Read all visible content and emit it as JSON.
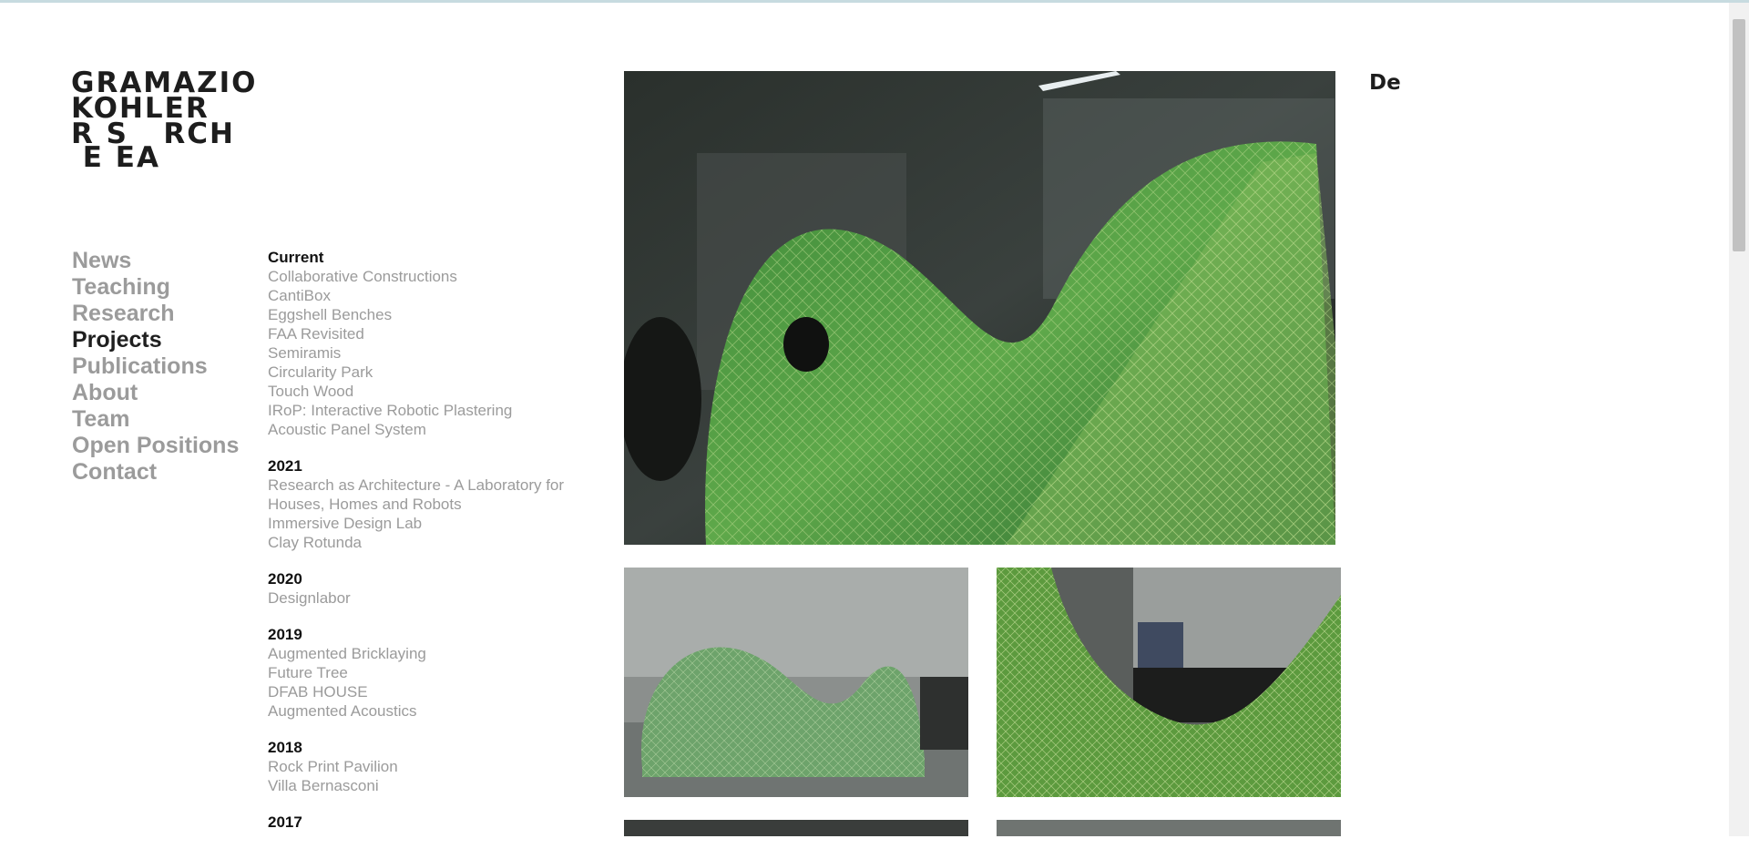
{
  "logo": {
    "line1": "GRAMAZIO",
    "line2": "KOHLER",
    "line3": "R S   RCH",
    "line4": " E EA"
  },
  "nav": {
    "items": [
      {
        "label": "News",
        "active": false
      },
      {
        "label": "Teaching",
        "active": false
      },
      {
        "label": "Research",
        "active": false
      },
      {
        "label": "Projects",
        "active": true
      },
      {
        "label": "Publications",
        "active": false
      },
      {
        "label": "About",
        "active": false
      },
      {
        "label": "Team",
        "active": false
      },
      {
        "label": "Open Positions",
        "active": false
      },
      {
        "label": "Contact",
        "active": false
      }
    ]
  },
  "projects": {
    "groups": [
      {
        "year": "Current",
        "items": [
          "Collaborative Constructions",
          "CantiBox",
          "Eggshell Benches",
          "FAA Revisited",
          "Semiramis",
          "Circularity Park",
          "Touch Wood",
          "IRoP: Interactive Robotic Plastering",
          "Acoustic Panel System"
        ]
      },
      {
        "year": "2021",
        "items": [
          "Research as Architecture - A Laboratory for Houses, Homes and Robots",
          "Immersive Design Lab",
          "Clay Rotunda"
        ]
      },
      {
        "year": "2020",
        "items": [
          "Designlabor"
        ]
      },
      {
        "year": "2019",
        "items": [
          "Augmented Bricklaying",
          "Future Tree",
          "DFAB HOUSE",
          "Augmented Acoustics"
        ]
      },
      {
        "year": "2018",
        "items": [
          "Rock Print Pavilion",
          "Villa Bernasconi"
        ]
      },
      {
        "year": "2017",
        "items": []
      }
    ]
  },
  "detail": {
    "heading": "De"
  },
  "colors": {
    "nav_inactive": "#9b9b9b",
    "nav_active": "#1f1f1f",
    "text_dark": "#111111",
    "background": "#ffffff"
  },
  "images": {
    "hero": "green-lattice-structure-photo",
    "thumb1": "pavilion-overview-photo",
    "thumb2": "pavilion-closeup-photo"
  }
}
